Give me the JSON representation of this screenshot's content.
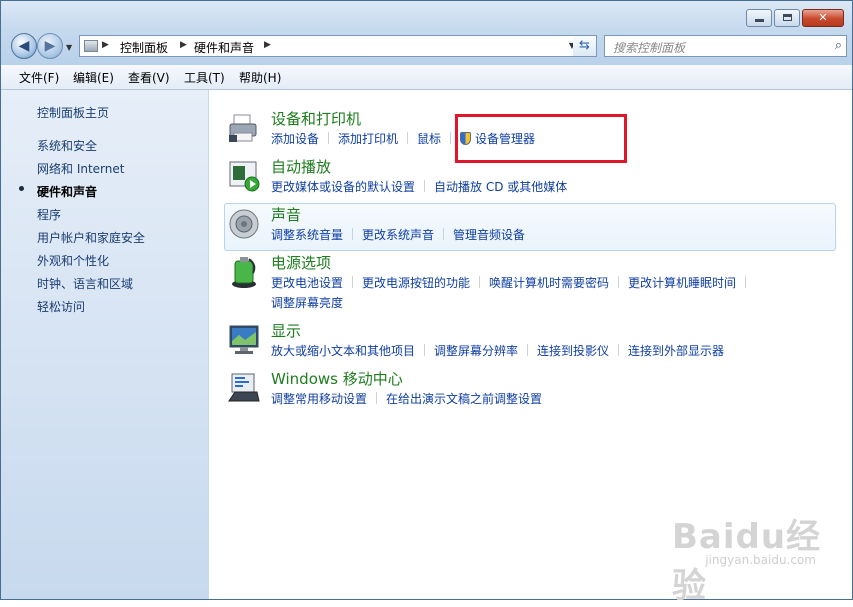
{
  "window": {
    "controls": {
      "minimize": "",
      "maximize": "",
      "close": "✕"
    }
  },
  "address_bar": {
    "breadcrumb": [
      "控制面板",
      "硬件和声音"
    ],
    "refresh_icon": "refresh-icon"
  },
  "search": {
    "placeholder": "搜索控制面板"
  },
  "menu": [
    {
      "label": "文件(F)"
    },
    {
      "label": "编辑(E)"
    },
    {
      "label": "查看(V)"
    },
    {
      "label": "工具(T)"
    },
    {
      "label": "帮助(H)"
    }
  ],
  "left_pane": {
    "items": [
      {
        "label": "控制面板主页"
      },
      {
        "label": "系统和安全"
      },
      {
        "label": "网络和 Internet"
      },
      {
        "label": "硬件和声音",
        "current": true
      },
      {
        "label": "程序"
      },
      {
        "label": "用户帐户和家庭安全"
      },
      {
        "label": "外观和个性化"
      },
      {
        "label": "时钟、语言和区域"
      },
      {
        "label": "轻松访问"
      }
    ]
  },
  "categories": [
    {
      "title": "设备和打印机",
      "icon": "printer-icon",
      "links": [
        "添加设备",
        "添加打印机",
        "鼠标",
        "设备管理器"
      ]
    },
    {
      "title": "自动播放",
      "icon": "autoplay-icon",
      "links": [
        "更改媒体或设备的默认设置",
        "自动播放 CD 或其他媒体"
      ]
    },
    {
      "title": "声音",
      "icon": "speaker-icon",
      "links": [
        "调整系统音量",
        "更改系统声音",
        "管理音频设备"
      ]
    },
    {
      "title": "电源选项",
      "icon": "battery-icon",
      "links": [
        "更改电池设置",
        "更改电源按钮的功能",
        "唤醒计算机时需要密码",
        "更改计算机睡眠时间"
      ],
      "links2": [
        "调整屏幕亮度"
      ]
    },
    {
      "title": "显示",
      "icon": "monitor-icon",
      "links": [
        "放大或缩小文本和其他项目",
        "调整屏幕分辨率",
        "连接到投影仪",
        "连接到外部显示器"
      ]
    },
    {
      "title": "Windows 移动中心",
      "icon": "mobility-center-icon",
      "links": [
        "调整常用移动设置",
        "在给出演示文稿之前调整设置"
      ]
    }
  ],
  "watermark": {
    "brand": "Baidu经验",
    "url": "jingyan.baidu.com"
  },
  "colors": {
    "category_title": "#1e7d1e",
    "link": "#0f3ea3",
    "highlight": "#e0172b"
  }
}
